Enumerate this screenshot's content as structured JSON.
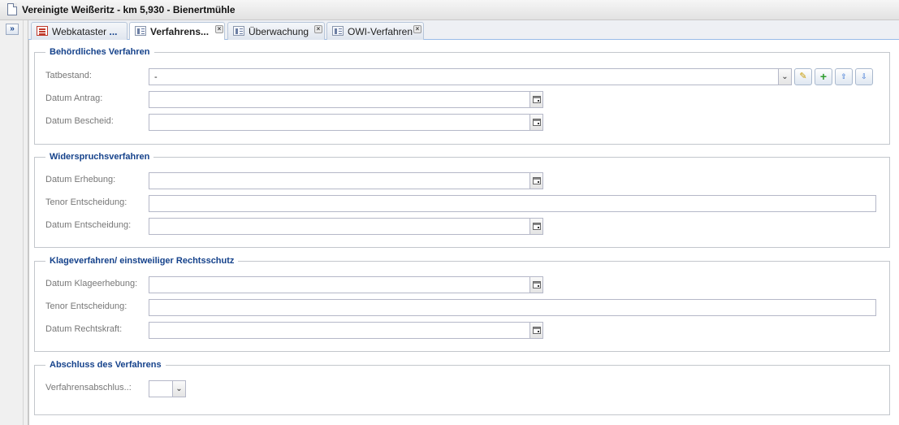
{
  "window": {
    "title": "Vereinigte Weißeritz - km 5,930 - Bienertmühle"
  },
  "sidebar": {
    "expand_glyph": "»"
  },
  "tabs": [
    {
      "label": "Webkataster",
      "suffix": "...",
      "icon": "list-icon",
      "closable": false
    },
    {
      "label": "Verfahrens...",
      "icon": "form-icon",
      "closable": true,
      "active": true
    },
    {
      "label": "Überwachung",
      "icon": "form-icon",
      "closable": true
    },
    {
      "label": "OWI-Verfahren",
      "icon": "form-icon",
      "closable": true
    }
  ],
  "sections": {
    "behoerdlich": {
      "legend": "Behördliches Verfahren",
      "tatbestand_label": "Tatbestand:",
      "tatbestand_value": "-",
      "datum_antrag_label": "Datum Antrag:",
      "datum_bescheid_label": "Datum Bescheid:"
    },
    "widerspruch": {
      "legend": "Widerspruchsverfahren",
      "datum_erhebung_label": "Datum Erhebung:",
      "tenor_label": "Tenor Entscheidung:",
      "datum_entscheidung_label": "Datum Entscheidung:"
    },
    "klage": {
      "legend": "Klageverfahren/ einstweiliger Rechtsschutz",
      "datum_klageerhebung_label": "Datum Klageerhebung:",
      "tenor_label": "Tenor Entscheidung:",
      "datum_rechtskraft_label": "Datum Rechtskraft:"
    },
    "abschluss": {
      "legend": "Abschluss des Verfahrens",
      "verfahrensabschluss_label": "Verfahrensabschlus..:"
    }
  },
  "glyphs": {
    "close": "×",
    "dropdown": "⌄",
    "edit": "✎",
    "add": "+",
    "up": "⇧",
    "down": "⇩"
  }
}
